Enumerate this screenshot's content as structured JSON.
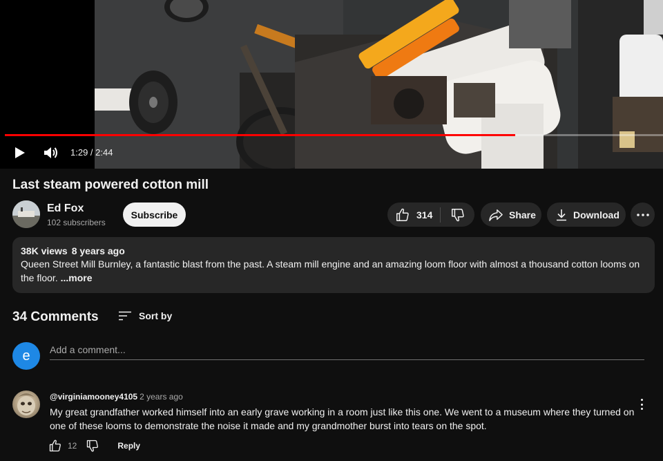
{
  "player": {
    "time": "1:29 / 2:44",
    "progress_fraction": 0.775,
    "progress_color": "#ff0000"
  },
  "video": {
    "title": "Last steam powered cotton mill"
  },
  "channel": {
    "name": "Ed Fox",
    "subscribers": "102 subscribers",
    "subscribe_label": "Subscribe"
  },
  "actions": {
    "like_count": "314",
    "share_label": "Share",
    "download_label": "Download"
  },
  "description": {
    "views": "38K views",
    "age": "8 years ago",
    "text": "Queen Street Mill Burnley, a fantastic blast from the past.  A steam mill engine and an amazing loom floor with almost a thousand cotton looms on the floor. ",
    "more_label": "...more"
  },
  "comments": {
    "count_label": "34 Comments",
    "sort_label": "Sort by",
    "current_user_initial": "e",
    "current_user_avatar_color": "#1e88e5",
    "add_placeholder": "Add a comment...",
    "items": [
      {
        "author": "@virginiamooney4105",
        "time": "2 years ago",
        "text": "My great grandfather worked himself into an early grave working in a room just like this one. We went to a museum where they turned on one of these looms to demonstrate the noise it made and my grandmother burst into tears on the spot.",
        "like_count": "12",
        "reply_label": "Reply"
      }
    ]
  }
}
